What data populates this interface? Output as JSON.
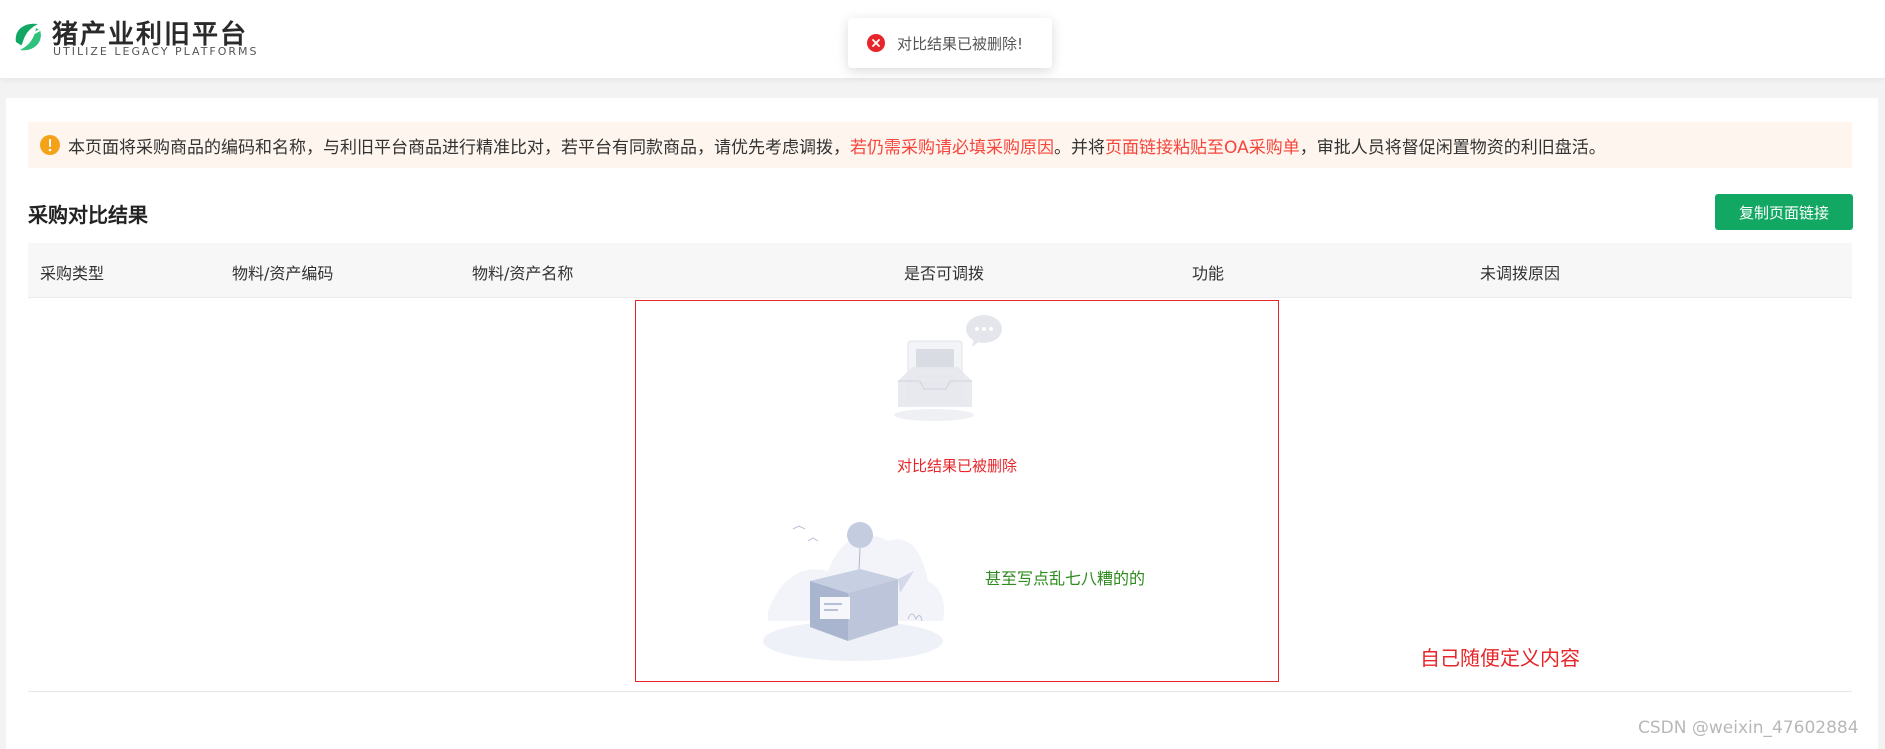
{
  "header": {
    "logo_title": "猪产业利旧平台",
    "logo_subtitle": "UTILIZE LEGACY PLATFORMS",
    "brand_color": "#12a863"
  },
  "toast": {
    "icon": "error-circle-icon",
    "message": "对比结果已被删除!",
    "color": "#e7262b"
  },
  "notice": {
    "icon": "info-circle-icon",
    "part1": "本页面将采购商品的编码和名称，与利旧平台商品进行精准比对，若平台有同款商品，请优先考虑调拨，",
    "part2_red": "若仍需采购请必填采购原因",
    "part3": "。并将",
    "part4_red": "页面链接粘贴至OA采购单",
    "part5": "，审批人员将督促闲置物资的利旧盘活。"
  },
  "section": {
    "title": "采购对比结果",
    "copy_button": "复制页面链接"
  },
  "table": {
    "columns": [
      "采购类型",
      "物料/资产编码",
      "物料/资产名称",
      "是否可调拨",
      "功能",
      "未调拨原因"
    ]
  },
  "empty": {
    "deleted_text": "对比结果已被删除",
    "green_text": "甚至写点乱七八糟的的",
    "inbox_icon": "empty-inbox-illustration",
    "box_icon": "empty-box-illustration"
  },
  "custom_note": "自己随便定义内容",
  "watermark": "CSDN @weixin_47602884"
}
